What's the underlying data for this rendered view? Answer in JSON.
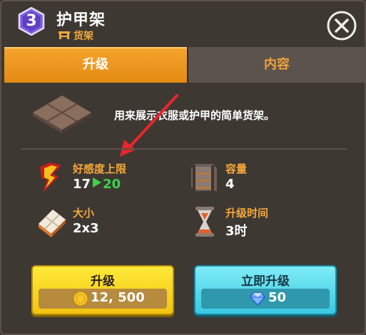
{
  "header": {
    "level": "3",
    "title": "护甲架",
    "subtitle": "货架"
  },
  "tabs": [
    {
      "label": "升级",
      "active": true
    },
    {
      "label": "内容",
      "active": false
    }
  ],
  "description": "用来展示衣服或护甲的简单货架。",
  "stats": {
    "favor_limit": {
      "label": "好感度上限",
      "current": "17",
      "next": "20"
    },
    "capacity": {
      "label": "容量",
      "value": "4"
    },
    "size": {
      "label": "大小",
      "value": "2x3"
    },
    "upgrade_time": {
      "label": "升级时间",
      "value": "3时"
    }
  },
  "buttons": {
    "upgrade": {
      "label": "升级",
      "cost": "12, 500"
    },
    "instant_upgrade": {
      "label": "立即升级",
      "cost": "50"
    }
  },
  "colors": {
    "accent_orange": "#f3a93a",
    "tab_active": "#f29b20",
    "upgrade_button": "#fbd724",
    "instant_button": "#4fd6ea",
    "increase_green": "#3bd34a",
    "arrow_red": "#e8262b"
  }
}
